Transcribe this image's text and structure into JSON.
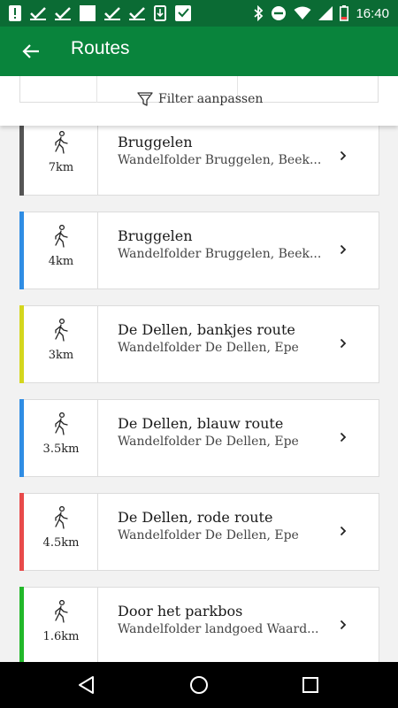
{
  "status_bar": {
    "time": "16:40"
  },
  "app_bar": {
    "title": "Routes"
  },
  "filter": {
    "label": "Filter aanpassen"
  },
  "routes": [
    {
      "distance": "7km",
      "title": "Bruggelen",
      "subtitle": "Wandelfolder Bruggelen, Beek...",
      "color": "#555555"
    },
    {
      "distance": "4km",
      "title": "Bruggelen",
      "subtitle": "Wandelfolder Bruggelen, Beek...",
      "color": "#2f8de4"
    },
    {
      "distance": "3km",
      "title": "De Dellen, bankjes route",
      "subtitle": "Wandelfolder De Dellen, Epe",
      "color": "#d4d61e"
    },
    {
      "distance": "3.5km",
      "title": "De Dellen, blauw route",
      "subtitle": "Wandelfolder De Dellen, Epe",
      "color": "#2f8de4"
    },
    {
      "distance": "4.5km",
      "title": "De Dellen, rode route",
      "subtitle": "Wandelfolder De Dellen, Epe",
      "color": "#e84a4a"
    },
    {
      "distance": "1.6km",
      "title": "Door het parkbos",
      "subtitle": "Wandelfolder landgoed Waard...",
      "color": "#22b82a"
    }
  ],
  "colors": {
    "app_bar": "#09843c",
    "status_bar": "#0b6b34"
  }
}
